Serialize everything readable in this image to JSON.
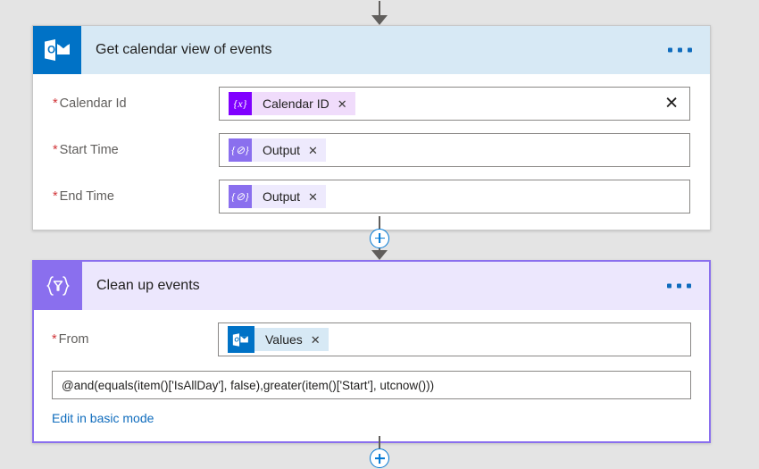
{
  "theme": {
    "canvas_bg": "#e4e4e4",
    "outlook_blue": "#0072c6",
    "outlook_header_bg": "#d7e9f5",
    "filter_purple": "#8a6fee",
    "filter_header_bg": "#ece7fd",
    "variable_purple": "#8000ff",
    "link_blue": "#0f6cbd",
    "required_red": "#d13438",
    "arrow_gray": "#605e5c"
  },
  "connectors": {
    "top": {
      "name": "arrow-down"
    },
    "middle": {
      "name": "insert-step-plus"
    },
    "bottom": {
      "name": "insert-step-plus"
    }
  },
  "cards": [
    {
      "id": "get-calendar-view-of-events",
      "title": "Get calendar view of events",
      "icon": "outlook-icon",
      "menu_label": "• • •",
      "params": [
        {
          "label": "Calendar Id",
          "required": true,
          "required_marker": "*",
          "token": {
            "kind": "variable",
            "icon_glyph": "{x}",
            "icon_name": "variable-token-icon",
            "text": "Calendar ID",
            "remove_label": "✕"
          },
          "has_clear_button": true,
          "clear_label": "✕"
        },
        {
          "label": "Start Time",
          "required": true,
          "required_marker": "*",
          "token": {
            "kind": "expression",
            "icon_glyph": "{⊘}",
            "icon_name": "expression-token-icon",
            "text": "Output",
            "remove_label": "✕"
          },
          "has_clear_button": false,
          "clear_label": ""
        },
        {
          "label": "End Time",
          "required": true,
          "required_marker": "*",
          "token": {
            "kind": "expression",
            "icon_glyph": "{⊘}",
            "icon_name": "expression-token-icon",
            "text": "Output",
            "remove_label": "✕"
          },
          "has_clear_button": false,
          "clear_label": ""
        }
      ]
    },
    {
      "id": "clean-up-events",
      "title": "Clean up events",
      "icon": "filter-array-icon",
      "icon_glyph": "{▽}",
      "menu_label": "• • •",
      "params": [
        {
          "label": "From",
          "required": true,
          "required_marker": "*",
          "token": {
            "kind": "outlook",
            "icon_name": "outlook-token-icon",
            "text": "Values",
            "remove_label": "✕"
          },
          "has_clear_button": false,
          "clear_label": ""
        }
      ],
      "expression": "@and(equals(item()['IsAllDay'], false),greater(item()['Start'], utcnow()))",
      "basic_mode_link": "Edit in basic mode"
    }
  ]
}
